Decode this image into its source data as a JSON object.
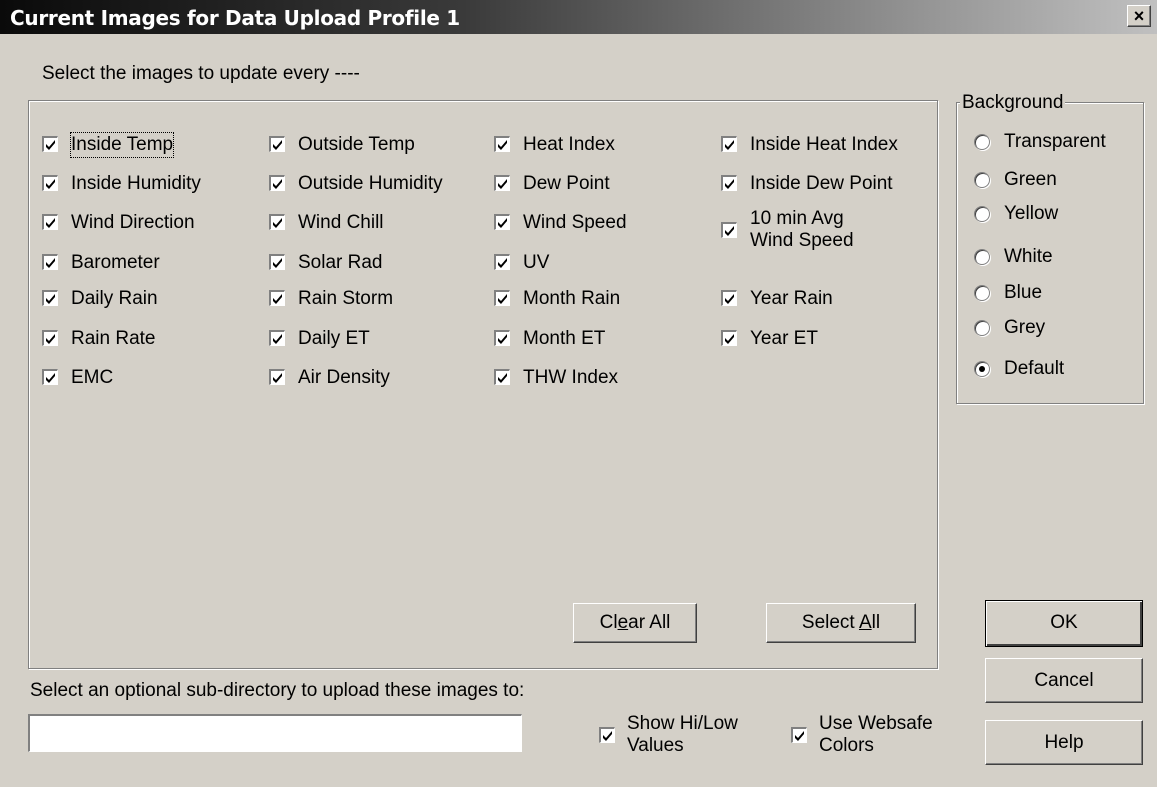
{
  "window": {
    "title": "Current Images for Data Upload Profile 1",
    "close_label": "×"
  },
  "instructions": "Select the images to update every ----",
  "images": {
    "inside_temp": "Inside Temp",
    "outside_temp": "Outside Temp",
    "heat_index": "Heat Index",
    "inside_heat_index": "Inside Heat Index",
    "inside_humidity": "Inside Humidity",
    "outside_humidity": "Outside Humidity",
    "dew_point": "Dew Point",
    "inside_dew_point": "Inside Dew Point",
    "wind_direction": "Wind Direction",
    "wind_chill": "Wind Chill",
    "wind_speed": "Wind Speed",
    "avg_wind_speed_line1": "10 min Avg",
    "avg_wind_speed_line2": "Wind Speed",
    "barometer": "Barometer",
    "solar_rad": "Solar Rad",
    "uv": "UV",
    "daily_rain": "Daily Rain",
    "rain_storm": "Rain Storm",
    "month_rain": "Month Rain",
    "year_rain": "Year Rain",
    "rain_rate": "Rain Rate",
    "daily_et": "Daily ET",
    "month_et": "Month ET",
    "year_et": "Year ET",
    "emc": "EMC",
    "air_density": "Air Density",
    "thw_index": "THW Index"
  },
  "buttons": {
    "clear_all_pre": "Cl",
    "clear_all_key": "e",
    "clear_all_post": "ar All",
    "select_all_pre": "Select ",
    "select_all_key": "A",
    "select_all_post": "ll",
    "ok": "OK",
    "cancel": "Cancel",
    "help": "Help"
  },
  "background": {
    "legend": "Background",
    "options": [
      "Transparent",
      "Green",
      "Yellow",
      "White",
      "Blue",
      "Grey",
      "Default"
    ],
    "selected": "Default"
  },
  "subdirectory": {
    "label": "Select an optional sub-directory to upload these images to:",
    "value": ""
  },
  "options": {
    "show_hilow_line1": "Show Hi/Low",
    "show_hilow_line2": "Values",
    "websafe_line1": "Use Websafe",
    "websafe_line2": "Colors"
  }
}
